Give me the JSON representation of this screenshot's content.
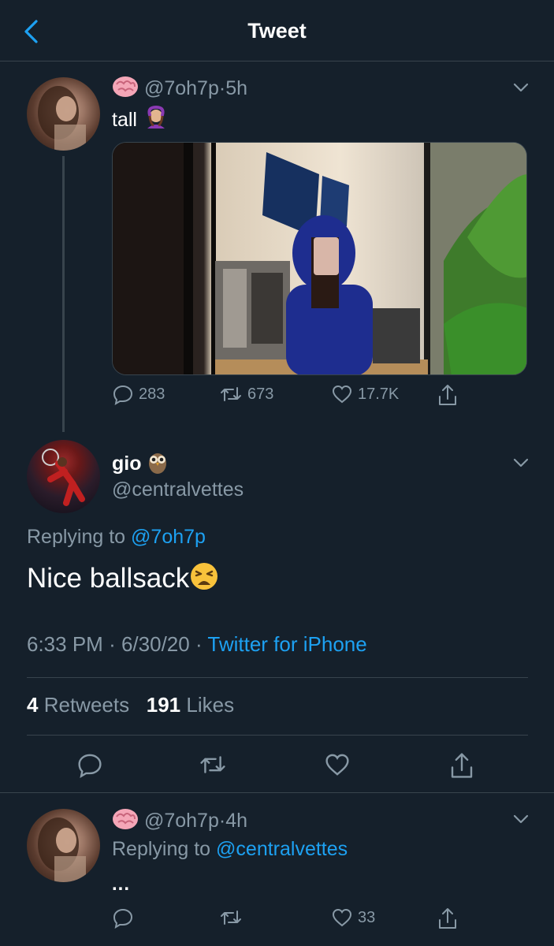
{
  "header": {
    "title": "Tweet"
  },
  "tweet_original": {
    "handle": "@7oh7p",
    "separator": "·",
    "time": "5h",
    "text": "tall",
    "counts": {
      "replies": "283",
      "retweets": "673",
      "likes": "17.7K"
    }
  },
  "main_reply": {
    "name": "gio",
    "handle": "@centralvettes",
    "replying_prefix": "Replying to",
    "replying_to": "@7oh7p",
    "text": "Nice ballsack",
    "time": "6:33 PM",
    "dot": "·",
    "date": "6/30/20",
    "source": "Twitter for iPhone",
    "retweets_count": "4",
    "retweets_label": "Retweets",
    "likes_count": "191",
    "likes_label": "Likes"
  },
  "bottom_reply": {
    "handle": "@7oh7p",
    "separator": "·",
    "time": "4h",
    "replying_prefix": "Replying to",
    "replying_to": "@centralvettes",
    "text": "...",
    "counts": {
      "likes": "33"
    }
  },
  "colors": {
    "background": "#15202b",
    "accent": "#1da1f2",
    "muted": "#8899a6",
    "divider": "#38444d"
  },
  "icons": [
    "back-chevron-icon",
    "brain-emoji-icon",
    "gesture-emoji-icon",
    "owl-emoji-icon",
    "weary-emoji-icon",
    "caret-down-icon",
    "reply-icon",
    "retweet-icon",
    "like-icon",
    "share-icon"
  ]
}
